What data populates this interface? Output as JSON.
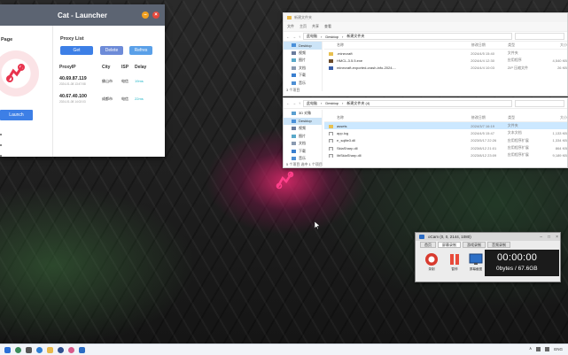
{
  "launcher": {
    "title": "Cat - Launcher",
    "min_label": "–",
    "close_label": "×",
    "side_title": "Page",
    "launch_label": "Launch",
    "proxy_title": "Proxy List",
    "get_label": "Get",
    "delete_label": "Delete",
    "refresh_label": "Refres",
    "columns": [
      "ProxyIP",
      "City",
      "ISP",
      "Delay"
    ],
    "rows": [
      {
        "ip": "40.69.87.119",
        "sub": "2024-01-08 13:47:58",
        "city": "佛山市",
        "isp": "电信",
        "delay": "19ms"
      },
      {
        "ip": "40.67.40.100",
        "sub": "2024-01-08 14:02:03",
        "city": "成都市",
        "isp": "电信",
        "delay": "22ms"
      }
    ],
    "accent": "#3d7fe6",
    "delete_color": "#6d8bd8",
    "refresh_color": "#5aa0e8",
    "delay_color": "#1fb5c7"
  },
  "explorer1": {
    "window_title": "新建文件夹",
    "tabs": [
      "文件",
      "主页",
      "共享",
      "查看"
    ],
    "path": [
      "此电脑",
      "Desktop",
      "新建文件夹"
    ],
    "nav": [
      {
        "label": "Desktop",
        "selected": true
      },
      {
        "label": "视频",
        "selected": false
      },
      {
        "label": "图片",
        "selected": false
      },
      {
        "label": "文档",
        "selected": false
      },
      {
        "label": "下载",
        "selected": false
      },
      {
        "label": "音乐",
        "selected": false
      }
    ],
    "headers": [
      "名称",
      "修改日期",
      "类型",
      "大小"
    ],
    "files": [
      {
        "name": ".minecraft",
        "date": "2024/4/5 15:40",
        "type": "文件夹",
        "size": "",
        "icon": "folder"
      },
      {
        "name": "HMCL-3.5.5.exe",
        "date": "2024/4/4 12:30",
        "type": "应用程序",
        "size": "4,540 KB",
        "icon": "exe"
      },
      {
        "name": "minecraft-exported-crash-info-2024-...",
        "date": "2024/4/4 10:03",
        "type": "ZIP 压缩文件",
        "size": "26 KB",
        "icon": "zip"
      }
    ],
    "status": "3 个项目"
  },
  "explorer2": {
    "path": [
      "此电脑",
      "Desktop",
      "新建文件夹 (4)"
    ],
    "nav": [
      {
        "label": "3D 对象",
        "selected": false
      },
      {
        "label": "Desktop",
        "selected": true
      },
      {
        "label": "视频",
        "selected": false
      },
      {
        "label": "图片",
        "selected": false
      },
      {
        "label": "文档",
        "selected": false
      },
      {
        "label": "下载",
        "selected": false
      },
      {
        "label": "音乐",
        "selected": false
      }
    ],
    "headers": [
      "名称",
      "修改日期",
      "类型",
      "大小"
    ],
    "files": [
      {
        "name": "assets",
        "date": "2024/3/7 16:19",
        "type": "文件夹",
        "size": "",
        "icon": "folder",
        "selected": true
      },
      {
        "name": "app.log",
        "date": "2024/4/5 15:47",
        "type": "文本文档",
        "size": "1,133 KB",
        "icon": "doc",
        "selected": false
      },
      {
        "name": "e_sqlite3.dll",
        "date": "2023/5/17 22:26",
        "type": "应用程序扩展",
        "size": "1,334 KB",
        "icon": "dll",
        "selected": false
      },
      {
        "name": "SkiaSharp.dll",
        "date": "2023/8/12 21:01",
        "type": "应用程序扩展",
        "size": "864 KB",
        "icon": "dll",
        "selected": false
      },
      {
        "name": "libSkiaSharp.dll",
        "date": "2023/8/12 23:09",
        "type": "应用程序扩展",
        "size": "9,189 KB",
        "icon": "dll",
        "selected": false
      }
    ],
    "status": "5 个项目  选中 1 个项目"
  },
  "ocam": {
    "title": "oCam (0, 0, 2144, 1080)",
    "tabs": [
      "首页",
      "屏幕录制",
      "游戏录制",
      "音频录制"
    ],
    "active_tab": 1,
    "tools": [
      "录制",
      "暂停",
      "屏幕截图"
    ],
    "timer": "00:00:00",
    "storage": "0bytes / 67.6GB"
  },
  "taskbar": {
    "tray": [
      "∧",
      "ENG"
    ]
  }
}
